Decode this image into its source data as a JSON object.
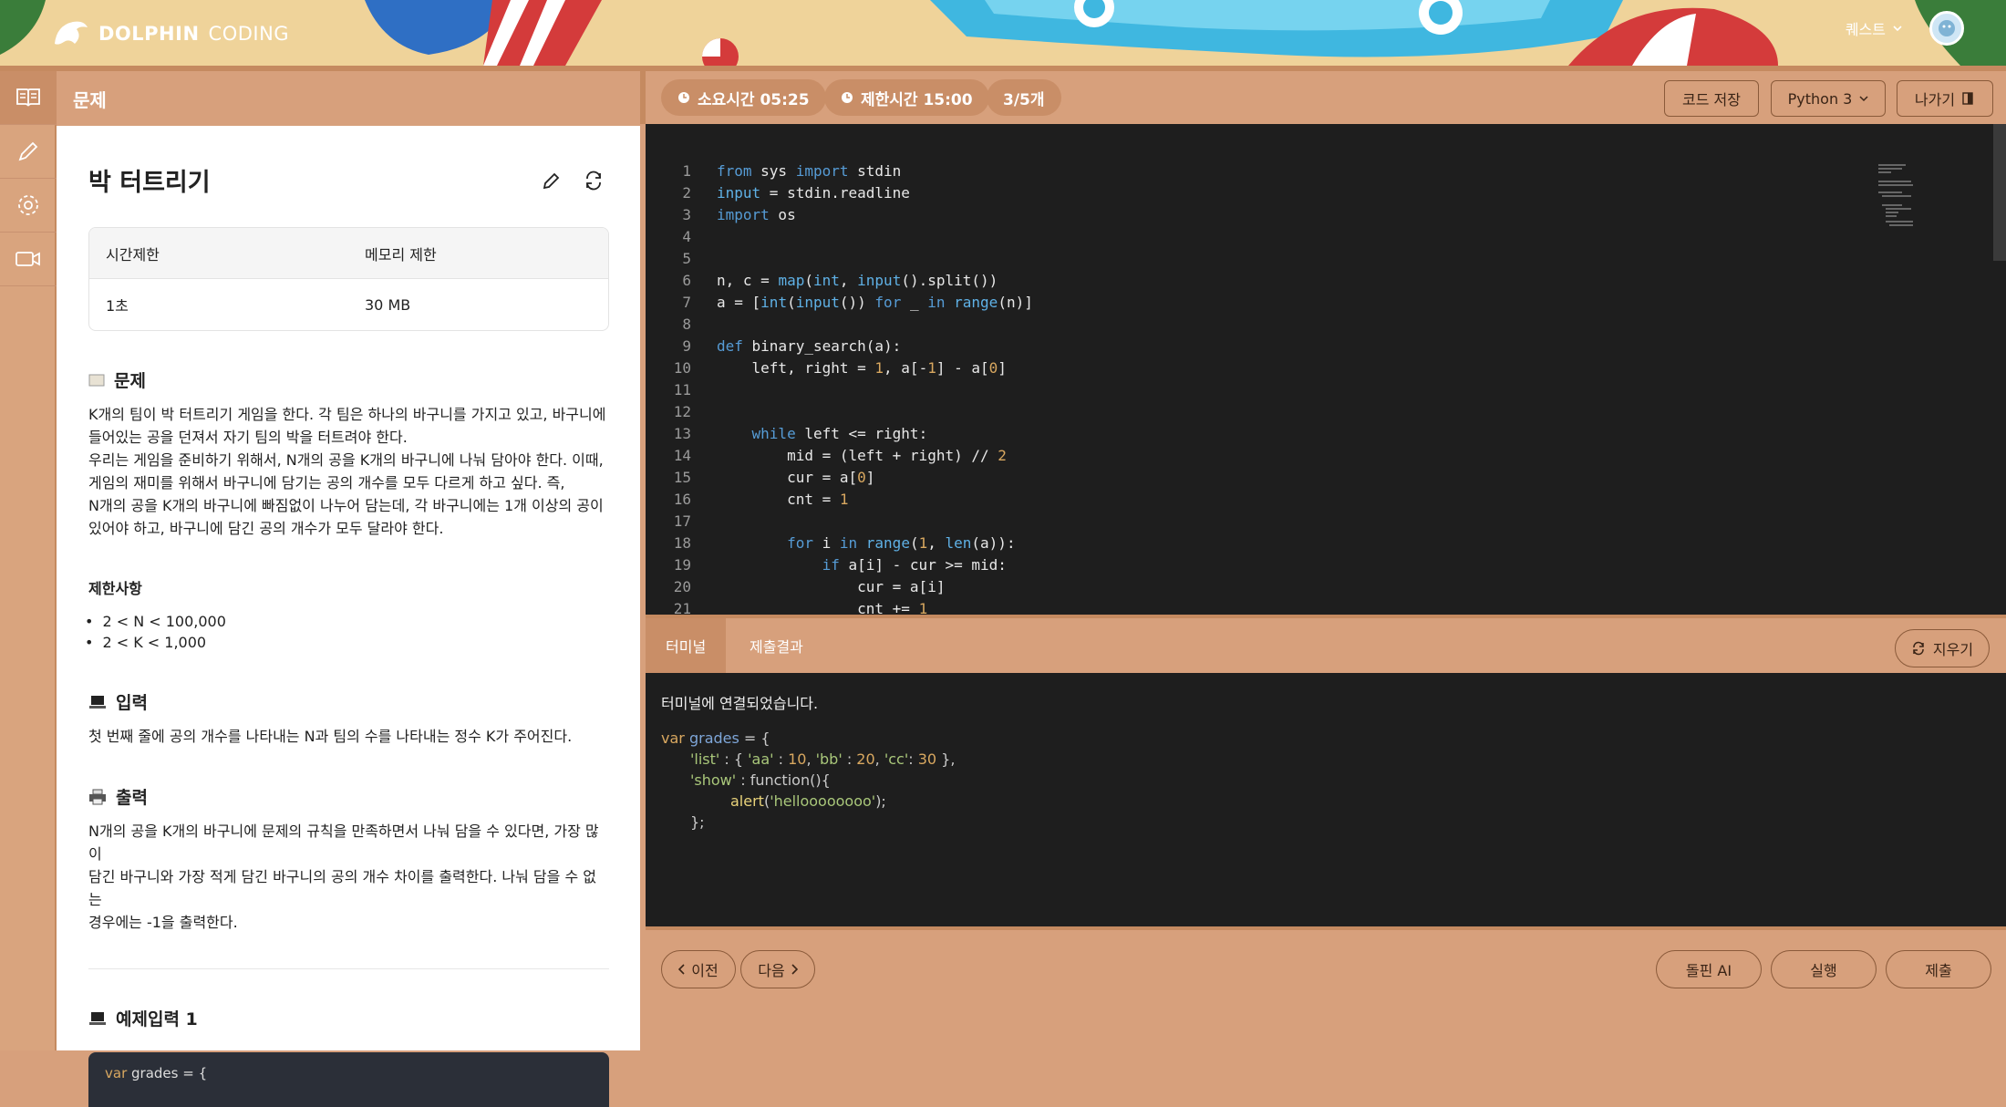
{
  "header": {
    "logo_bold": "DOLPHIN",
    "logo_light": "CODING",
    "user_menu": "퀘스트"
  },
  "sidebar": {
    "items": [
      {
        "icon": "book-icon",
        "active": true
      },
      {
        "icon": "pencil-icon",
        "active": false
      },
      {
        "icon": "gear-icon",
        "active": false
      },
      {
        "icon": "video-icon",
        "active": false
      }
    ]
  },
  "problem": {
    "panel_title": "문제",
    "title": "박 터트리기",
    "limits": {
      "time_header": "시간제한",
      "memory_header": "메모리 제한",
      "time_value": "1초",
      "memory_value": "30 MB"
    },
    "description_heading": "문제",
    "description": [
      "K개의 팀이 박 터트리기 게임을 한다. 각 팀은 하나의 바구니를 가지고 있고, 바구니에",
      "들어있는 공을 던져서 자기 팀의 박을 터트려야 한다.",
      "우리는 게임을 준비하기 위해서, N개의 공을 K개의 바구니에 나눠 담아야 한다. 이때,",
      "게임의 재미를 위해서 바구니에 담기는 공의 개수를 모두 다르게 하고 싶다. 즉,",
      "N개의 공을 K개의 바구니에 빠짐없이 나누어 담는데, 각 바구니에는 1개 이상의 공이",
      "있어야 하고, 바구니에 담긴 공의 개수가 모두 달라야 한다."
    ],
    "constraints_heading": "제한사항",
    "constraints": [
      "2 < N < 100,000",
      "2 < K < 1,000"
    ],
    "input_heading": "입력",
    "input_text": "첫 번째 줄에 공의 개수를 나타내는 N과 팀의 수를 나타내는 정수 K가 주어진다.",
    "output_heading": "출력",
    "output_text": [
      "N개의 공을 K개의 바구니에 문제의 규칙을 만족하면서 나눠 담을 수 있다면, 가장 많이",
      "담긴 바구니와 가장 적게 담긴 바구니의 공의 개수 차이를 출력한다. 나눠 담을 수 없는",
      "경우에는 -1을 출력한다."
    ],
    "example_heading": "예제입력 1",
    "example_code_var": "var",
    "example_code_rest": " grades = {"
  },
  "toolbar": {
    "elapsed_label": "소요시간 05:25",
    "limit_label": "제한시간 15:00",
    "progress_label": "3/5개",
    "save_label": "코드 저장",
    "language_label": "Python 3",
    "exit_label": "나가기"
  },
  "editor": {
    "lines": [
      "from sys import stdin",
      "input = stdin.readline",
      "import os",
      "",
      "",
      "n, c = map(int, input().split())",
      "a = [int(input()) for _ in range(n)]",
      "",
      "def binary_search(a):",
      "    left, right = 1, a[-1] - a[0]",
      "",
      "",
      "    while left <= right:",
      "        mid = (left + right) // 2",
      "        cur = a[0]",
      "        cnt = 1",
      "",
      "        for i in range(1, len(a)):",
      "            if a[i] - cur >= mid:",
      "                cur = a[i]",
      "                cnt += 1"
    ]
  },
  "terminal": {
    "tab_terminal": "터미널",
    "tab_result": "제출결과",
    "clear_label": "지우기",
    "connected": "터미널에 연결되었습니다.",
    "code": [
      "var grades = {",
      "'list' : { 'aa' : 10, 'bb' : 20, 'cc': 30 },",
      "'show' : function(){",
      "alert('helloooooooo');",
      "};"
    ]
  },
  "footer": {
    "prev_label": "이전",
    "next_label": "다음",
    "ai_label": "돌핀 AI",
    "run_label": "실행",
    "submit_label": "제출"
  }
}
